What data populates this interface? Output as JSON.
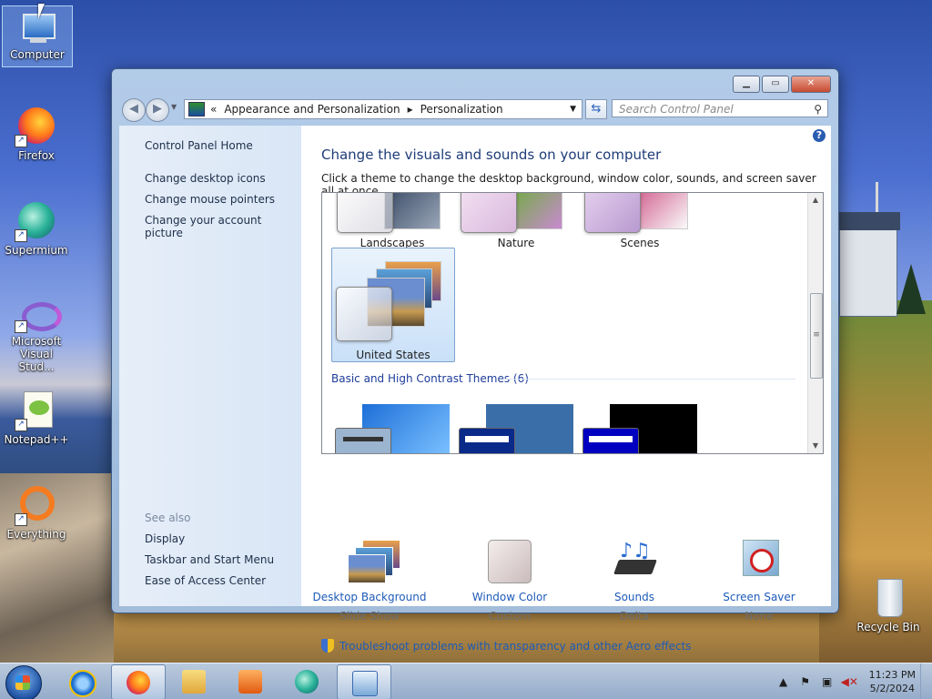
{
  "desktop": {
    "icons": [
      {
        "label": "Computer"
      },
      {
        "label": "Firefox"
      },
      {
        "label": "Supermium"
      },
      {
        "label": "Microsoft Visual Stud..."
      },
      {
        "label": "Notepad++"
      },
      {
        "label": "Everything"
      }
    ],
    "recycle_bin": {
      "label": "Recycle Bin"
    }
  },
  "window": {
    "controls": {
      "minimize": "▁",
      "maximize": "▭",
      "close": "✕"
    },
    "address": {
      "back_chevrons": "«",
      "crumb1": "Appearance and Personalization",
      "separator": "▸",
      "crumb2": "Personalization"
    },
    "search": {
      "placeholder": "Search Control Panel"
    },
    "sidebar": {
      "home": "Control Panel Home",
      "links": [
        "Change desktop icons",
        "Change mouse pointers",
        "Change your account picture"
      ],
      "see_also_title": "See also",
      "see_also": [
        "Display",
        "Taskbar and Start Menu",
        "Ease of Access Center"
      ]
    },
    "main": {
      "title": "Change the visuals and sounds on your computer",
      "description": "Click a theme to change the desktop background, window color, sounds, and screen saver all at once.",
      "themes": [
        "Landscapes",
        "Nature",
        "Scenes",
        "United States"
      ],
      "basic_group_title": "Basic and High Contrast Themes (6)",
      "bottom": [
        {
          "label": "Desktop Background",
          "value": "Slide Show"
        },
        {
          "label": "Window Color",
          "value": "Custom"
        },
        {
          "label": "Sounds",
          "value": "Delta"
        },
        {
          "label": "Screen Saver",
          "value": "None"
        }
      ],
      "troubleshoot": "Troubleshoot problems with transparency and other Aero effects"
    }
  },
  "taskbar": {
    "clock_time": "11:23 PM",
    "clock_date": "5/2/2024"
  }
}
